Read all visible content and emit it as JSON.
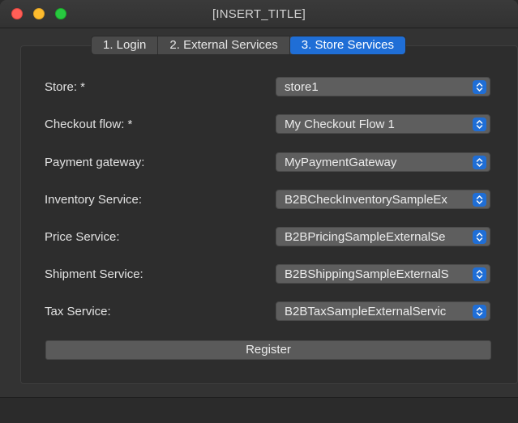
{
  "window": {
    "title": "[INSERT_TITLE]"
  },
  "tabs": [
    {
      "label": "1. Login"
    },
    {
      "label": "2. External Services"
    },
    {
      "label": "3. Store Services"
    }
  ],
  "form": {
    "fields": [
      {
        "label": "Store: *",
        "value": "store1"
      },
      {
        "label": "Checkout flow: *",
        "value": "My Checkout Flow 1"
      },
      {
        "label": "Payment gateway:",
        "value": "MyPaymentGateway"
      },
      {
        "label": "Inventory Service:",
        "value": "B2BCheckInventorySampleEx"
      },
      {
        "label": "Price Service:",
        "value": "B2BPricingSampleExternalSe"
      },
      {
        "label": "Shipment Service:",
        "value": "B2BShippingSampleExternalS"
      },
      {
        "label": "Tax Service:",
        "value": "B2BTaxSampleExternalServic"
      }
    ],
    "register_label": "Register"
  },
  "colors": {
    "accent": "#1f6ed6",
    "window_bg": "#333333",
    "select_bg": "#5e5e5e"
  }
}
